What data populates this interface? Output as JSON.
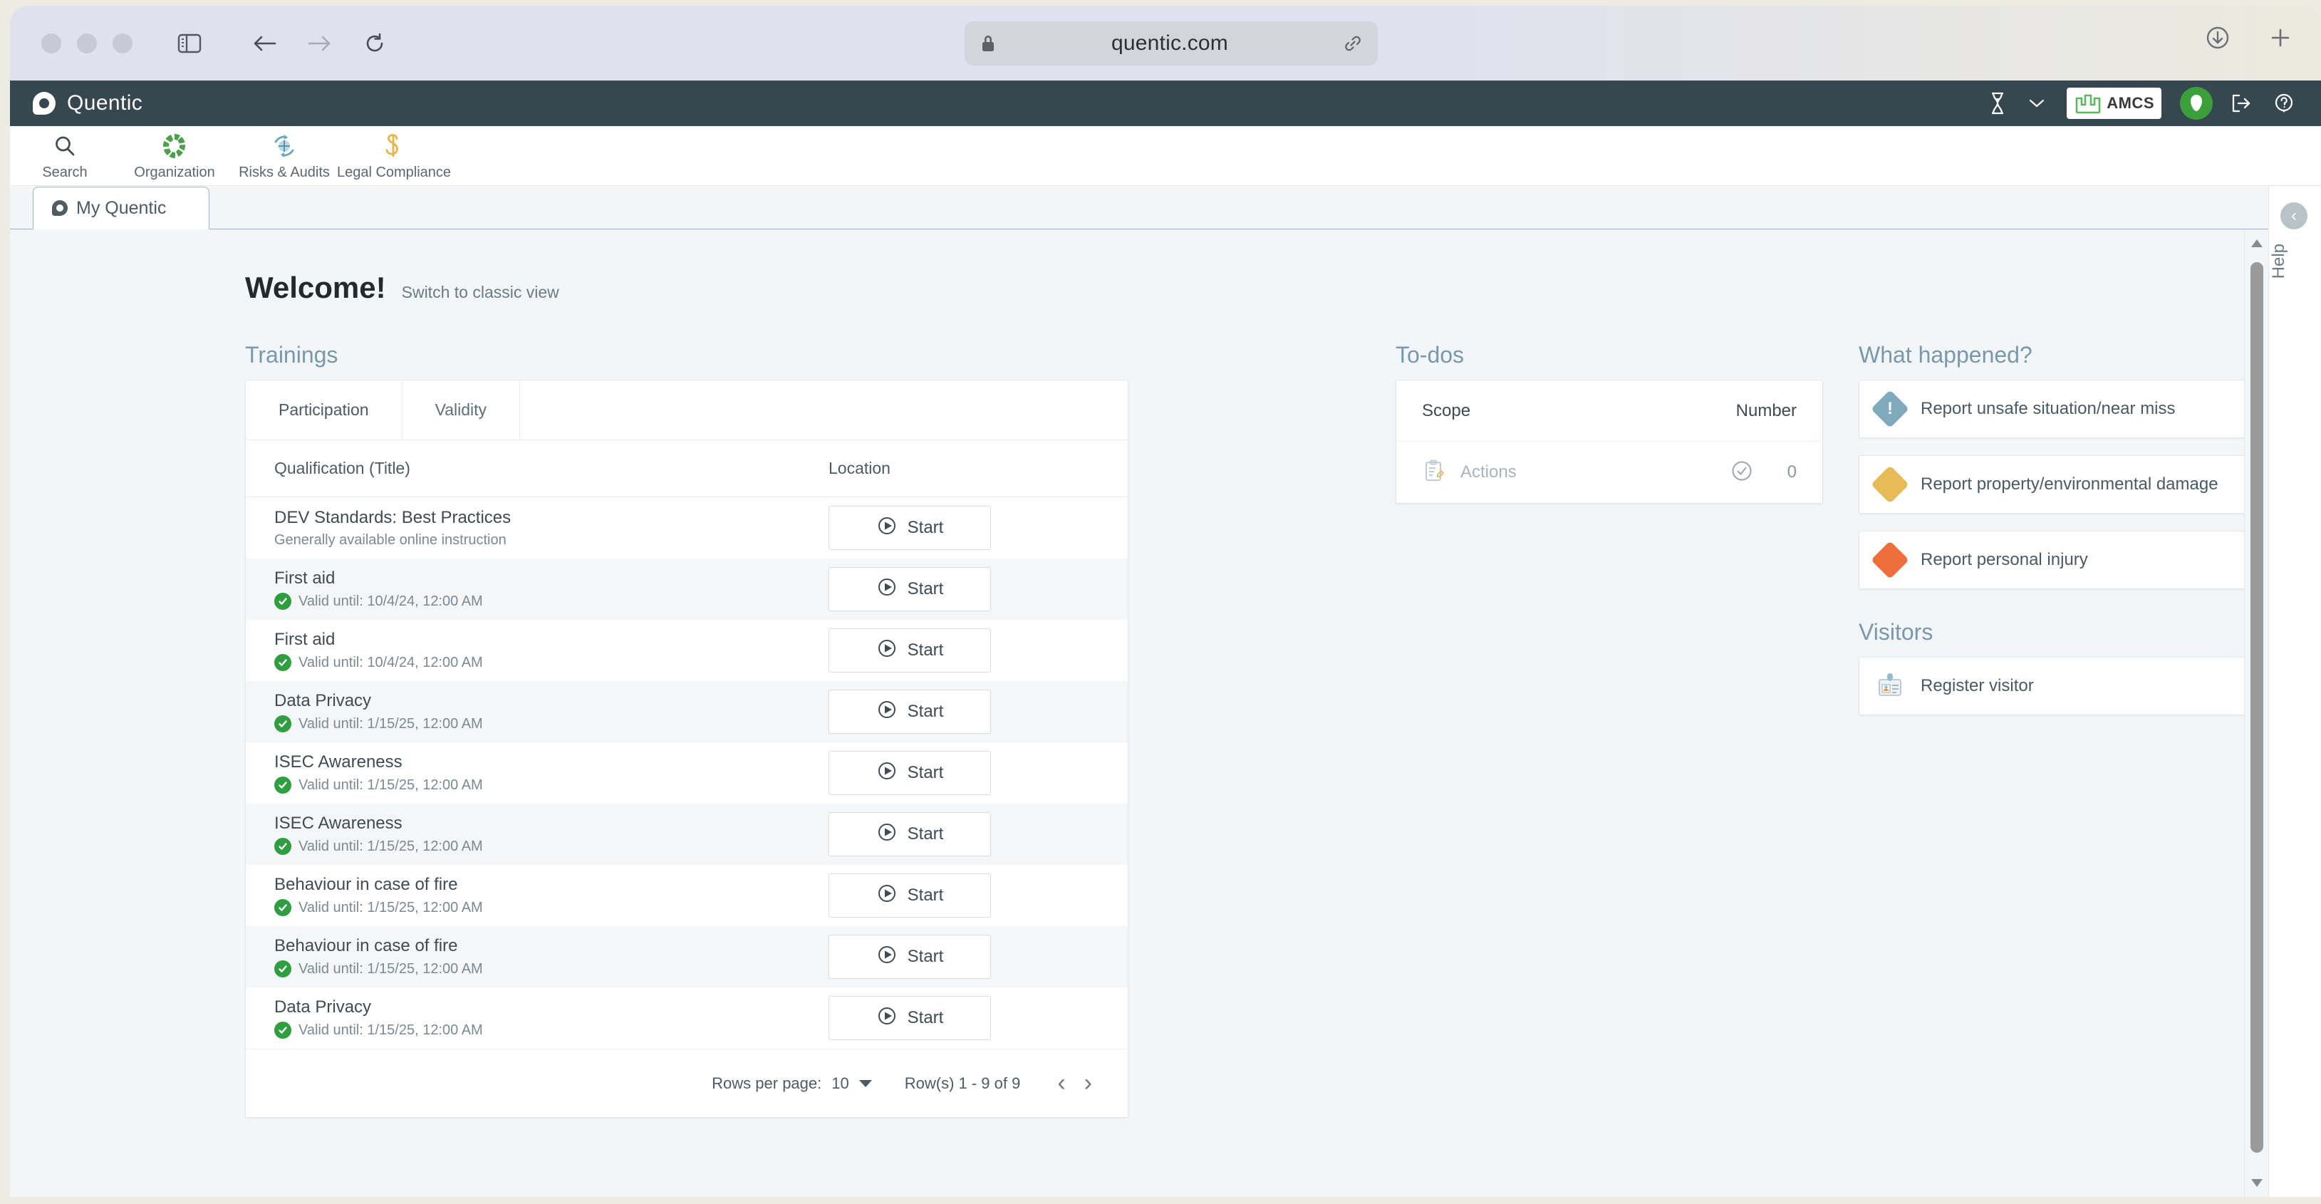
{
  "browser": {
    "url": "quentic.com",
    "lock_icon": "lock-icon",
    "link_icon": "link-icon",
    "sidebar_icon": "sidebar-toggle-icon",
    "back_icon": "back-arrow-icon",
    "forward_icon": "forward-arrow-icon",
    "reload_icon": "reload-icon",
    "download_icon": "download-icon",
    "newtab_icon": "plus-icon"
  },
  "app": {
    "brand": "Quentic",
    "header_icons": {
      "hourglass": "hourglass-icon",
      "chevron": "chevron-down-icon",
      "logout": "logout-icon",
      "help": "help-circle-icon"
    },
    "tenant_logo_text": "AMCS"
  },
  "module_nav": [
    {
      "label": "Search",
      "icon": "search-icon"
    },
    {
      "label": "Organization",
      "icon": "organization-icon"
    },
    {
      "label": "Risks & Audits",
      "icon": "risks-audits-icon"
    },
    {
      "label": "Legal Compliance",
      "icon": "legal-compliance-icon"
    }
  ],
  "tabs": [
    {
      "label": "My Quentic",
      "active": true
    }
  ],
  "welcome": {
    "title": "Welcome!",
    "switch_link": "Switch to classic view"
  },
  "trainings": {
    "section_title": "Trainings",
    "tabs": [
      {
        "label": "Participation",
        "active": true
      },
      {
        "label": "Validity",
        "active": false
      }
    ],
    "columns": [
      "Qualification (Title)",
      "Location"
    ],
    "action_label": "Start",
    "rows": [
      {
        "title": "DEV Standards: Best Practices",
        "sub": "Generally available online instruction",
        "has_check": false
      },
      {
        "title": "First aid",
        "sub": "Valid until: 10/4/24, 12:00 AM",
        "has_check": true
      },
      {
        "title": "First aid",
        "sub": "Valid until: 10/4/24, 12:00 AM",
        "has_check": true
      },
      {
        "title": "Data Privacy",
        "sub": "Valid until: 1/15/25, 12:00 AM",
        "has_check": true
      },
      {
        "title": "ISEC Awareness",
        "sub": "Valid until: 1/15/25, 12:00 AM",
        "has_check": true
      },
      {
        "title": "ISEC Awareness",
        "sub": "Valid until: 1/15/25, 12:00 AM",
        "has_check": true
      },
      {
        "title": "Behaviour in case of fire",
        "sub": "Valid until: 1/15/25, 12:00 AM",
        "has_check": true
      },
      {
        "title": "Behaviour in case of fire",
        "sub": "Valid until: 1/15/25, 12:00 AM",
        "has_check": true
      },
      {
        "title": "Data Privacy",
        "sub": "Valid until: 1/15/25, 12:00 AM",
        "has_check": true
      }
    ],
    "footer": {
      "rows_per_page_label": "Rows per page:",
      "rows_per_page_value": "10",
      "range_label": "Row(s) 1 - 9 of 9",
      "prev_icon": "chevron-left-icon",
      "next_icon": "chevron-right-icon"
    }
  },
  "todos": {
    "section_title": "To-dos",
    "columns": {
      "scope": "Scope",
      "number": "Number"
    },
    "rows": [
      {
        "label": "Actions",
        "icon": "clipboard-edit-icon",
        "status_icon": "check-circle-icon",
        "number": "0"
      }
    ]
  },
  "what_happened": {
    "section_title": "What happened?",
    "items": [
      {
        "label": "Report unsafe situation/near miss",
        "icon": "alert-diamond-icon",
        "color": "#7fa9bd",
        "glyph": "!"
      },
      {
        "label": "Report property/environmental damage",
        "icon": "property-damage-diamond-icon",
        "color": "#e8bb56",
        "glyph": ""
      },
      {
        "label": "Report personal injury",
        "icon": "personal-injury-diamond-icon",
        "color": "#ef6f3c",
        "glyph": ""
      }
    ]
  },
  "visitors": {
    "section_title": "Visitors",
    "items": [
      {
        "label": "Register visitor",
        "icon": "id-badge-icon"
      }
    ]
  },
  "help_rail": {
    "label": "Help",
    "collapse_icon": "chevron-left-circle-icon"
  },
  "colors": {
    "app_header": "#36474f",
    "section_heading": "#7a98ab",
    "accent_green": "#2e9e3e",
    "page_bg": "#f2f6f8"
  }
}
